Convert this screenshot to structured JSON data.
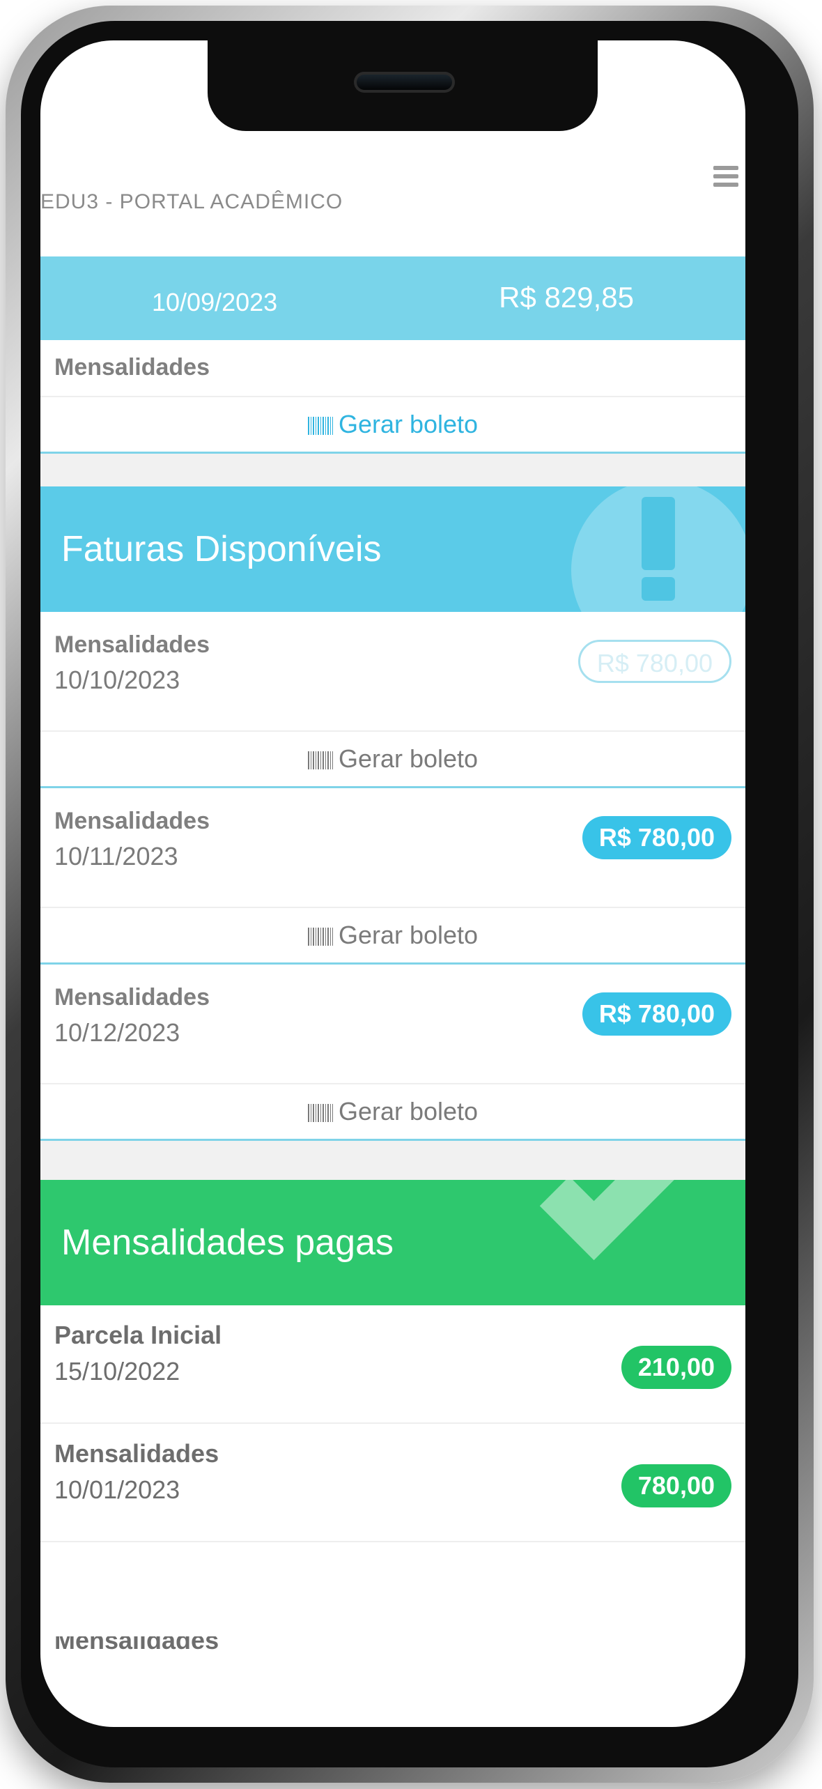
{
  "header": {
    "title": "EDU3 - PORTAL ACADÊMICO"
  },
  "top_strip": {
    "date": "10/09/2023",
    "value": "R$ 829,85"
  },
  "top_item": {
    "label": "Mensalidades",
    "action": "Gerar boleto"
  },
  "faturas": {
    "title": "Faturas Disponíveis",
    "items": [
      {
        "label": "Mensalidades",
        "date": "10/10/2023",
        "value": "R$ 780,00",
        "action": "Gerar boleto"
      },
      {
        "label": "Mensalidades",
        "date": "10/11/2023",
        "value": "R$ 780,00",
        "action": "Gerar boleto"
      },
      {
        "label": "Mensalidades",
        "date": "10/12/2023",
        "value": "R$ 780,00",
        "action": "Gerar boleto"
      }
    ]
  },
  "pagas": {
    "title": "Mensalidades pagas",
    "items": [
      {
        "label": "Parcela Inicial",
        "date": "15/10/2022",
        "value": "210,00"
      },
      {
        "label": "Mensalidades",
        "date": "10/01/2023",
        "value": "780,00"
      },
      {
        "label": "Mensalidades"
      }
    ]
  },
  "icons": {
    "menu": "hamburger-menu-icon",
    "barcode": "barcode-icon",
    "alert": "exclamation-icon",
    "check": "checkmark-icon"
  },
  "colors": {
    "blue": "#5bcbe8",
    "blue_pill": "#38c3e8",
    "green": "#2ec86e",
    "link": "#2fb4e0"
  }
}
